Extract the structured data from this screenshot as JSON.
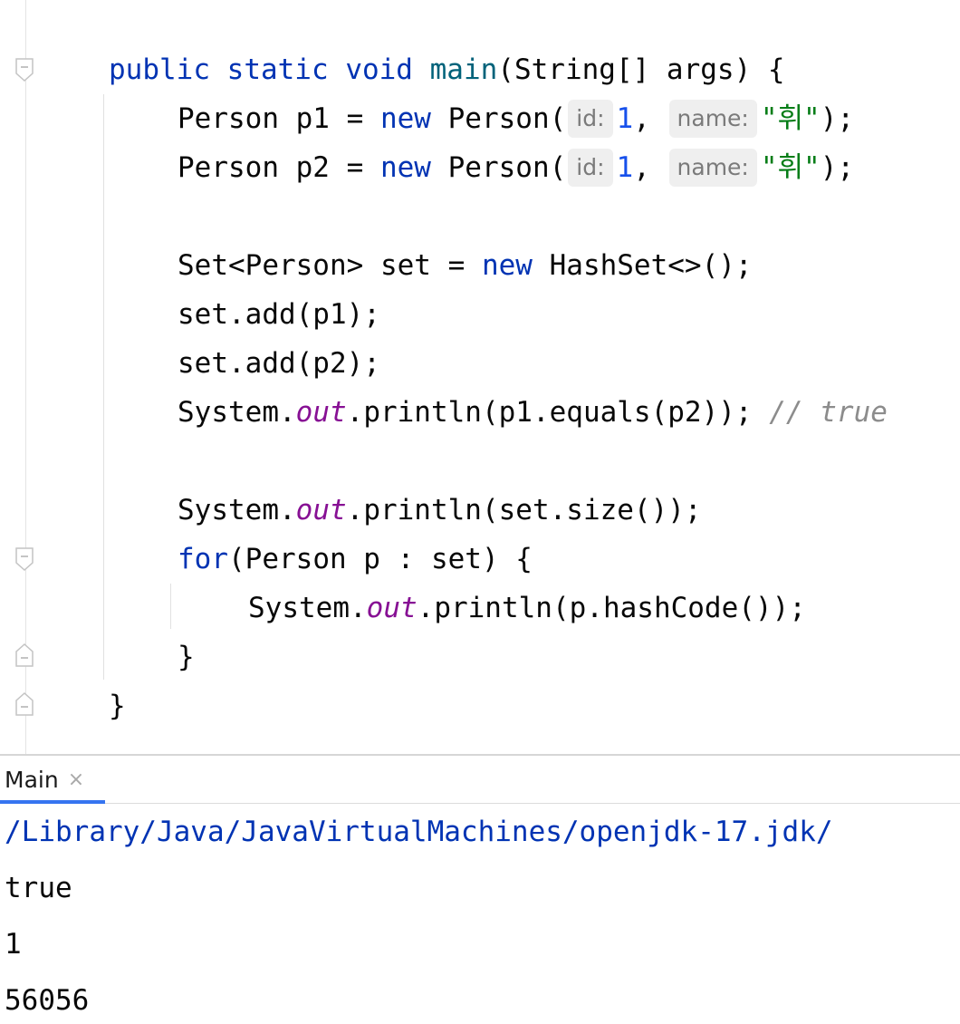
{
  "editor": {
    "lines": {
      "l1": {
        "kw1": "public",
        "kw2": "static",
        "kw3": "void",
        "fn": "main",
        "rest": "(String[] args) {"
      },
      "l2": {
        "t1": "Person p1 = ",
        "kw": "new",
        "t2": " Person(",
        "hint_id": "id:",
        "num": "1",
        "comma": ", ",
        "hint_name": "name:",
        "str": "\"휘\"",
        "end": ");"
      },
      "l3": {
        "t1": "Person p2 = ",
        "kw": "new",
        "t2": " Person(",
        "hint_id": "id:",
        "num": "1",
        "comma": ", ",
        "hint_name": "name:",
        "str": "\"휘\"",
        "end": ");"
      },
      "l4": {
        "t1": "Set<Person> set = ",
        "kw": "new",
        "t2": " HashSet<>();"
      },
      "l5": {
        "text": "set.add(p1);"
      },
      "l6": {
        "text": "set.add(p2);"
      },
      "l7": {
        "t1": "System.",
        "field": "out",
        "t2": ".println(p1.equals(p2)); ",
        "comment": "// true"
      },
      "l8": {
        "t1": "System.",
        "field": "out",
        "t2": ".println(set.size());"
      },
      "l9": {
        "kw": "for",
        "t2": "(Person p : set) {"
      },
      "l10": {
        "t1": "System.",
        "field": "out",
        "t2": ".println(p.hashCode());"
      },
      "l11": {
        "text": "}"
      },
      "l12": {
        "text": "}"
      }
    }
  },
  "run_panel": {
    "tab_label": "Main",
    "close_glyph": "×",
    "accent_color": "#3574f0"
  },
  "console": {
    "command": "/Library/Java/JavaVirtualMachines/openjdk-17.jdk/",
    "output": [
      "true",
      "1",
      "56056"
    ]
  }
}
